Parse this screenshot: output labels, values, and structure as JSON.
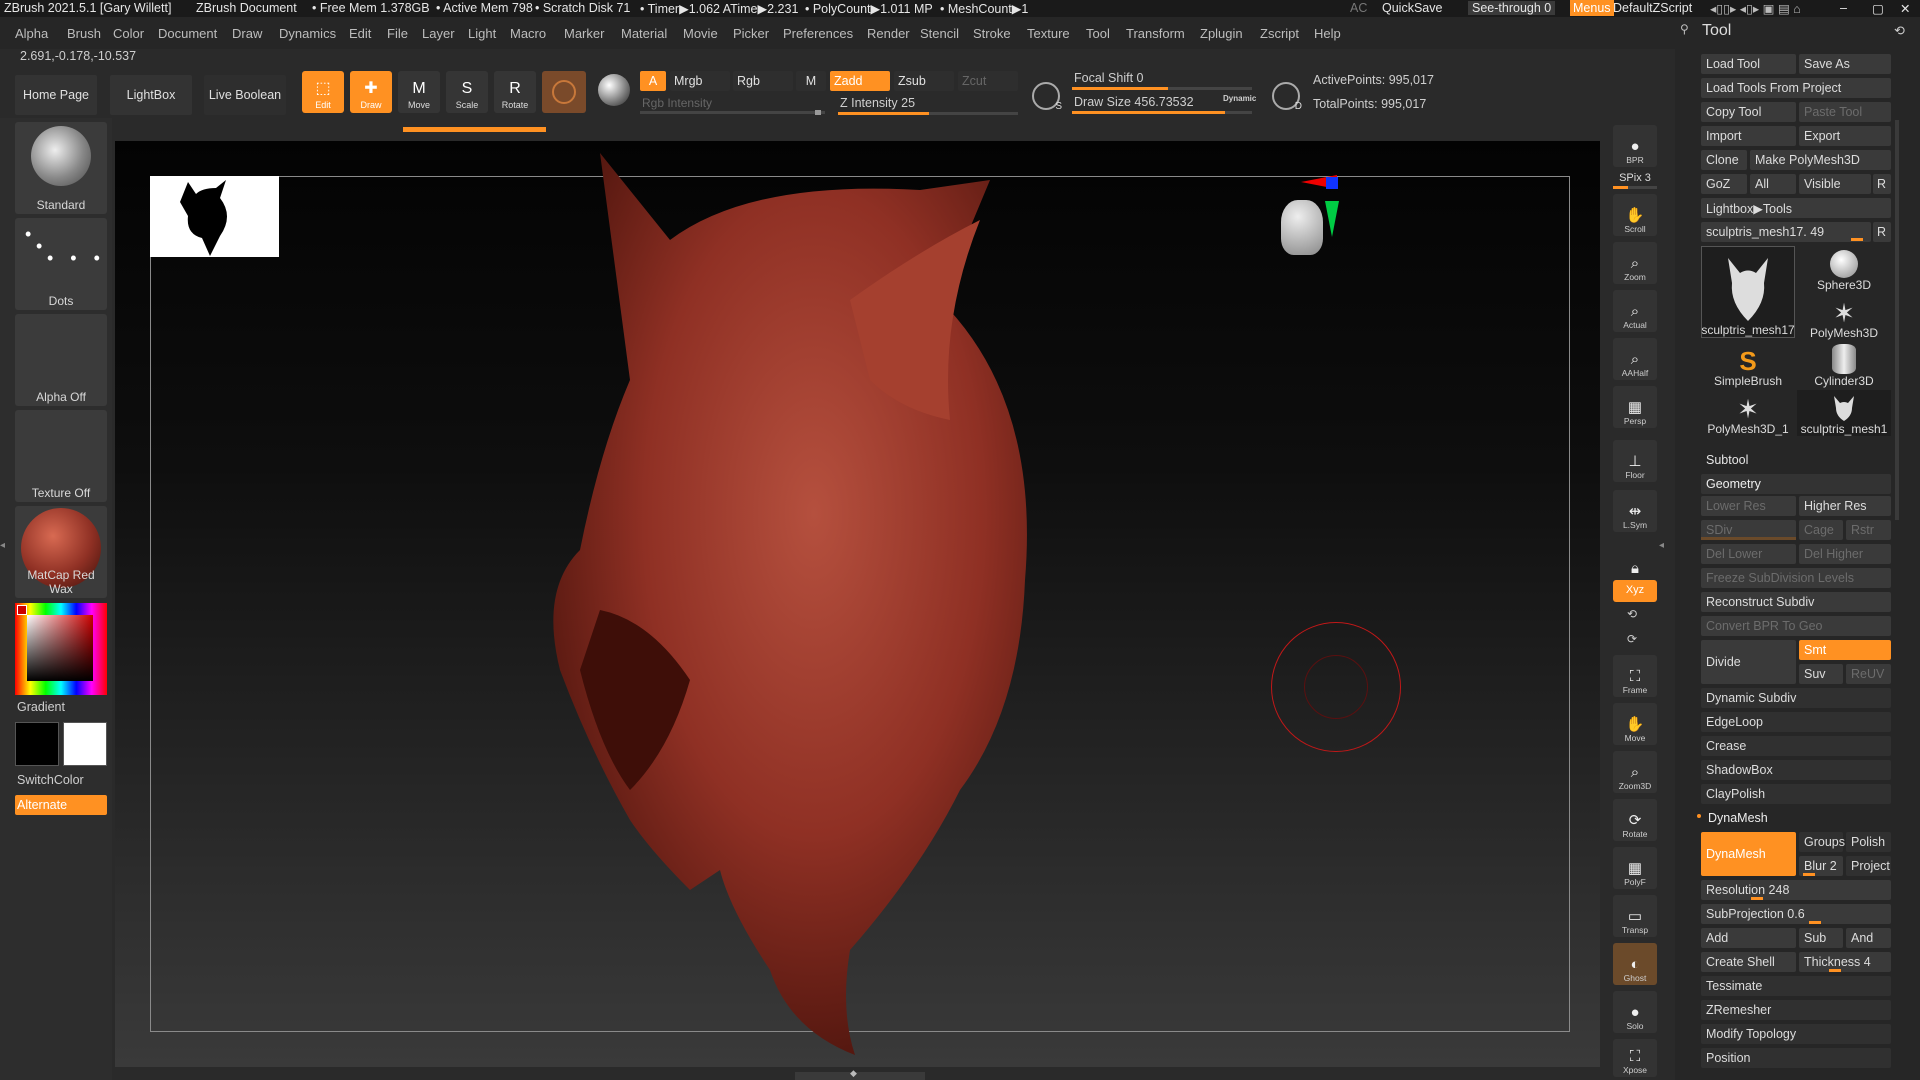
{
  "titlebar": {
    "app": "ZBrush 2021.5.1 [Gary Willett]",
    "document": "ZBrush Document",
    "free_mem": "• Free Mem 1.378GB",
    "active_mem": "• Active Mem 798",
    "scratch": "• Scratch Disk 71",
    "timer": "• Timer▶1.062 ATime▶2.231",
    "polycount": "• PolyCount▶1.011 MP",
    "meshcount": "• MeshCount▶1",
    "ac": "AC",
    "quicksave": "QuickSave",
    "seethrough": "See-through",
    "seethrough_value": "0",
    "menus": "Menus",
    "script": "DefaultZScript"
  },
  "menu": [
    "Alpha",
    "Brush",
    "Color",
    "Document",
    "Draw",
    "Dynamics",
    "Edit",
    "File",
    "Layer",
    "Light",
    "Macro",
    "Marker",
    "Material",
    "Movie",
    "Picker",
    "Preferences",
    "Render",
    "Stencil",
    "Stroke",
    "Texture",
    "Tool",
    "Transform",
    "Zplugin",
    "Zscript",
    "Help"
  ],
  "coords": "2.691,-0.178,-10.537",
  "toolbar": {
    "home": "Home Page",
    "lightbox": "LightBox",
    "live_boolean": "Live Boolean",
    "edit": "Edit",
    "draw": "Draw",
    "move": "Move",
    "scale": "Scale",
    "rotate": "Rotate",
    "a": "A",
    "mrgb": "Mrgb",
    "rgb": "Rgb",
    "m": "M",
    "zadd": "Zadd",
    "zsub": "Zsub",
    "zcut": "Zcut",
    "rgb_intensity": "Rgb Intensity",
    "z_intensity": "Z Intensity 25",
    "focal_shift": "Focal Shift 0",
    "draw_size": "Draw Size 456.73532",
    "dynamic": "Dynamic",
    "active_points": "ActivePoints: 995,017",
    "total_points": "TotalPoints: 995,017",
    "s_label": "S",
    "d_label": "D"
  },
  "left": {
    "brush": "Standard",
    "stroke": "Dots",
    "alpha": "Alpha Off",
    "texture": "Texture Off",
    "material": "MatCap Red Wax",
    "gradient": "Gradient",
    "switchcolor": "SwitchColor",
    "alternate": "Alternate"
  },
  "right_shelf": [
    "BPR",
    "SPix 3",
    "Scroll",
    "Zoom",
    "Actual",
    "AAHalf",
    "Persp",
    "Floor",
    "L.Sym",
    "Xyz",
    "Frame",
    "Move",
    "Zoom3D",
    "Rotate",
    "PolyF",
    "Transp",
    "Ghost",
    "Solo",
    "Xpose"
  ],
  "tool": {
    "title": "Tool",
    "load_tool": "Load Tool",
    "save_as": "Save As",
    "load_from_project": "Load Tools From Project",
    "copy_tool": "Copy Tool",
    "paste_tool": "Paste Tool",
    "import": "Import",
    "export": "Export",
    "clone": "Clone",
    "make_polymesh": "Make PolyMesh3D",
    "goz": "GoZ",
    "all": "All",
    "visible": "Visible",
    "r": "R",
    "lightbox_tools": "Lightbox▶Tools",
    "current_tool": "sculptris_mesh17. 49",
    "tiles": [
      "sculptris_mesh17",
      "Sphere3D",
      "PolyMesh3D",
      "SimpleBrush",
      "Cylinder3D",
      "PolyMesh3D_1",
      "sculptris_mesh1"
    ],
    "subtool": "Subtool",
    "geometry": "Geometry",
    "lower_res": "Lower Res",
    "higher_res": "Higher Res",
    "sdiv": "SDiv",
    "cage": "Cage",
    "rstr": "Rstr",
    "del_lower": "Del Lower",
    "del_higher": "Del Higher",
    "freeze": "Freeze SubDivision Levels",
    "reconstruct": "Reconstruct Subdiv",
    "convert_bpr": "Convert BPR To Geo",
    "divide": "Divide",
    "smt": "Smt",
    "suv": "Suv",
    "reuv": "ReUV",
    "dynamic_subdiv": "Dynamic Subdiv",
    "edgeloop": "EdgeLoop",
    "crease": "Crease",
    "shadowbox": "ShadowBox",
    "claypolish": "ClayPolish",
    "dynamesh_header": "DynaMesh",
    "dynamesh": "DynaMesh",
    "groups": "Groups",
    "polish": "Polish",
    "blur": "Blur 2",
    "project": "Project",
    "resolution": "Resolution 248",
    "subprojection": "SubProjection 0.6",
    "add": "Add",
    "sub": "Sub",
    "and": "And",
    "create_shell": "Create Shell",
    "thickness": "Thickness 4",
    "tessimate": "Tessimate",
    "zremesher": "ZRemesher",
    "modify_topology": "Modify Topology",
    "position": "Position"
  },
  "colors": {
    "accent": "#ff9122",
    "model": "#8f3024",
    "brush_ring": "#c01818"
  }
}
